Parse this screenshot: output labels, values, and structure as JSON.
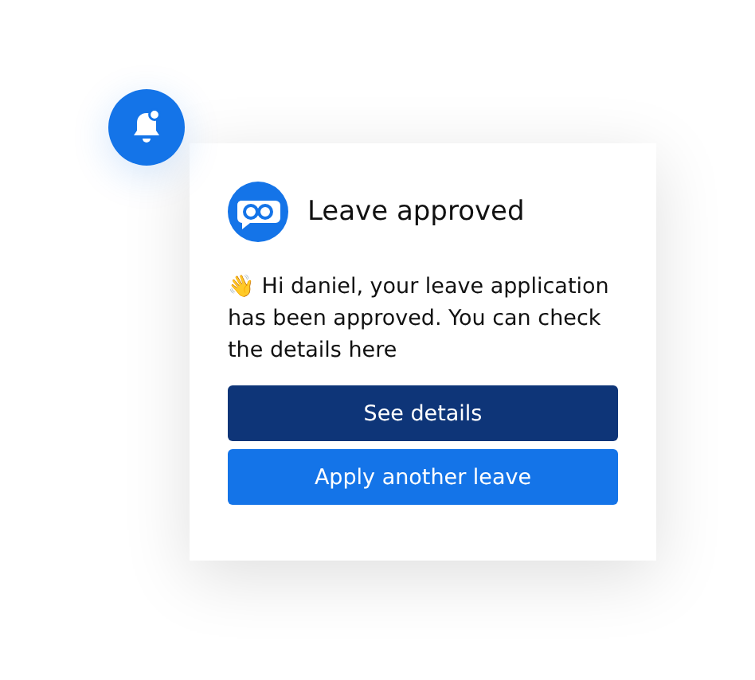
{
  "notification": {
    "title": "Leave approved",
    "message": "👋 Hi daniel, your leave application has been approved. You can check the details here",
    "buttons": [
      {
        "label": "See details",
        "kind": "primary"
      },
      {
        "label": "Apply another leave",
        "kind": "secondary"
      }
    ]
  }
}
